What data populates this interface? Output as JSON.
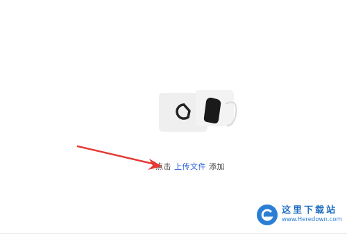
{
  "upload_prompt": {
    "click_text": "点击",
    "link_label": "上传文件",
    "suffix_text": "添加"
  },
  "watermark": {
    "title": "这里下载站",
    "url": "www.Heredown.com"
  },
  "colors": {
    "link": "#2b5fd9",
    "arrow": "#e53935",
    "watermark_blue": "#2a7fd4"
  },
  "icons": {
    "illustration": "upload-video-icon",
    "watermark_logo": "heredown-logo-icon"
  }
}
